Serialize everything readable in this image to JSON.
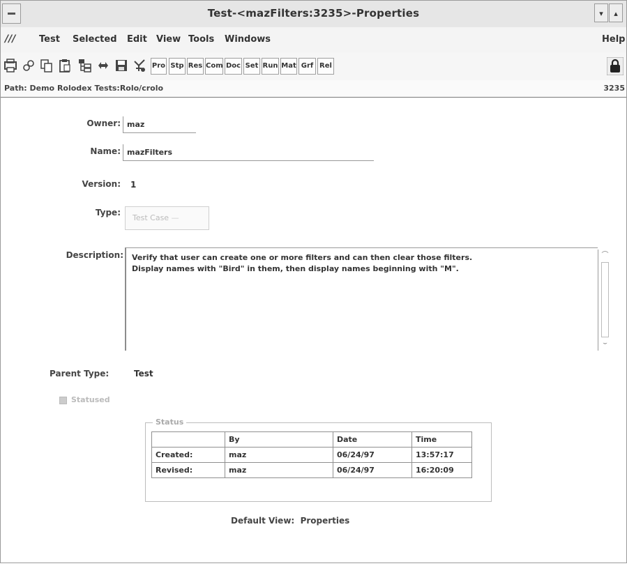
{
  "window": {
    "title": "Test-<mazFilters:3235>-Properties",
    "menu_arrow_down": "▾",
    "menu_arrow_up": "▴"
  },
  "menubar": {
    "logo": "///",
    "items": [
      {
        "label": "Test",
        "key": "test"
      },
      {
        "label": "Selected",
        "key": "selected"
      },
      {
        "label": "Edit",
        "key": "edit"
      },
      {
        "label": "View",
        "key": "view"
      },
      {
        "label": "Tools",
        "key": "tools"
      },
      {
        "label": "Windows",
        "key": "windows"
      }
    ],
    "help": "Help"
  },
  "toolbar": {
    "icons": [
      "print-icon",
      "link-icon",
      "copy-icon",
      "paste-icon",
      "hierarchy-icon",
      "refresh-icon",
      "save-icon",
      "run-icon"
    ],
    "text_buttons": [
      "Pro",
      "Stp",
      "Res",
      "Com",
      "Doc",
      "Set",
      "Run",
      "Mat",
      "Grf",
      "Rel"
    ],
    "lock_icon": "lock-icon"
  },
  "path": {
    "text": "Path: Demo Rolodex Tests:Rolo/crolo",
    "id": "3235"
  },
  "form": {
    "owner_label": "Owner:",
    "owner_value": "maz",
    "name_label": "Name:",
    "name_value": "mazFilters",
    "version_label": "Version:",
    "version_value": "1",
    "type_label": "Type:",
    "type_value": "Test Case",
    "description_label": "Description:",
    "description_value": "Verify that user can create one or more filters and can then clear those filters.\nDisplay names with \"Bird\" in them, then display names beginning with \"M\".",
    "parent_type_label": "Parent Type:",
    "parent_type_value": "Test",
    "statused_label": "Statused",
    "default_view_label": "Default View:",
    "default_view_value": "Properties"
  },
  "status": {
    "title": "Status",
    "headers": [
      "",
      "By",
      "Date",
      "Time"
    ],
    "rows": [
      [
        "Created:",
        "maz",
        "06/24/97",
        "13:57:17"
      ],
      [
        "Revised:",
        "maz",
        "06/24/97",
        "16:20:09"
      ]
    ]
  }
}
